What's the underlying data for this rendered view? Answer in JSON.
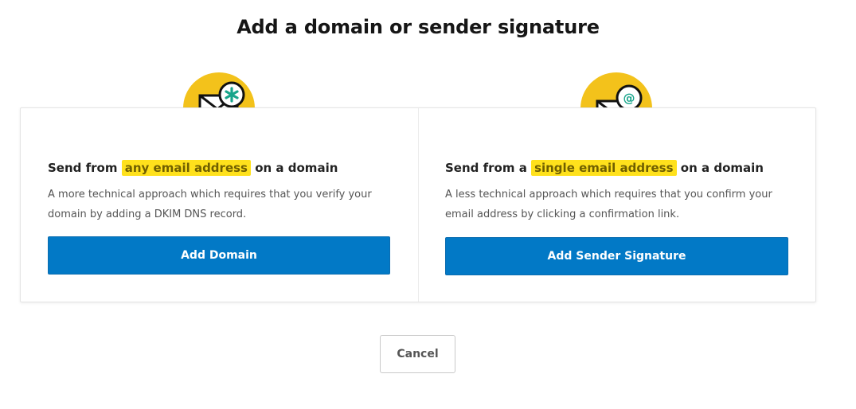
{
  "page_title": "Add a domain or sender signature",
  "colors": {
    "primary_button": "#0279c6",
    "highlight": "#ffe11c",
    "icon_circle": "#f3c21b",
    "icon_accent": "#18a58b"
  },
  "domain_card": {
    "icon": "envelope-asterisk-icon",
    "heading_pre": "Send from",
    "heading_highlight": "any email address",
    "heading_post": "on a domain",
    "description": "A more technical approach which requires that you verify your domain by adding a DKIM DNS record.",
    "button_label": "Add Domain"
  },
  "signature_card": {
    "icon": "envelope-at-icon",
    "heading_pre": "Send from a",
    "heading_highlight": "single email address",
    "heading_post": "on a domain",
    "description": "A less technical approach which requires that you confirm your email address by clicking a confirmation link.",
    "button_label": "Add Sender Signature"
  },
  "cancel_label": "Cancel"
}
